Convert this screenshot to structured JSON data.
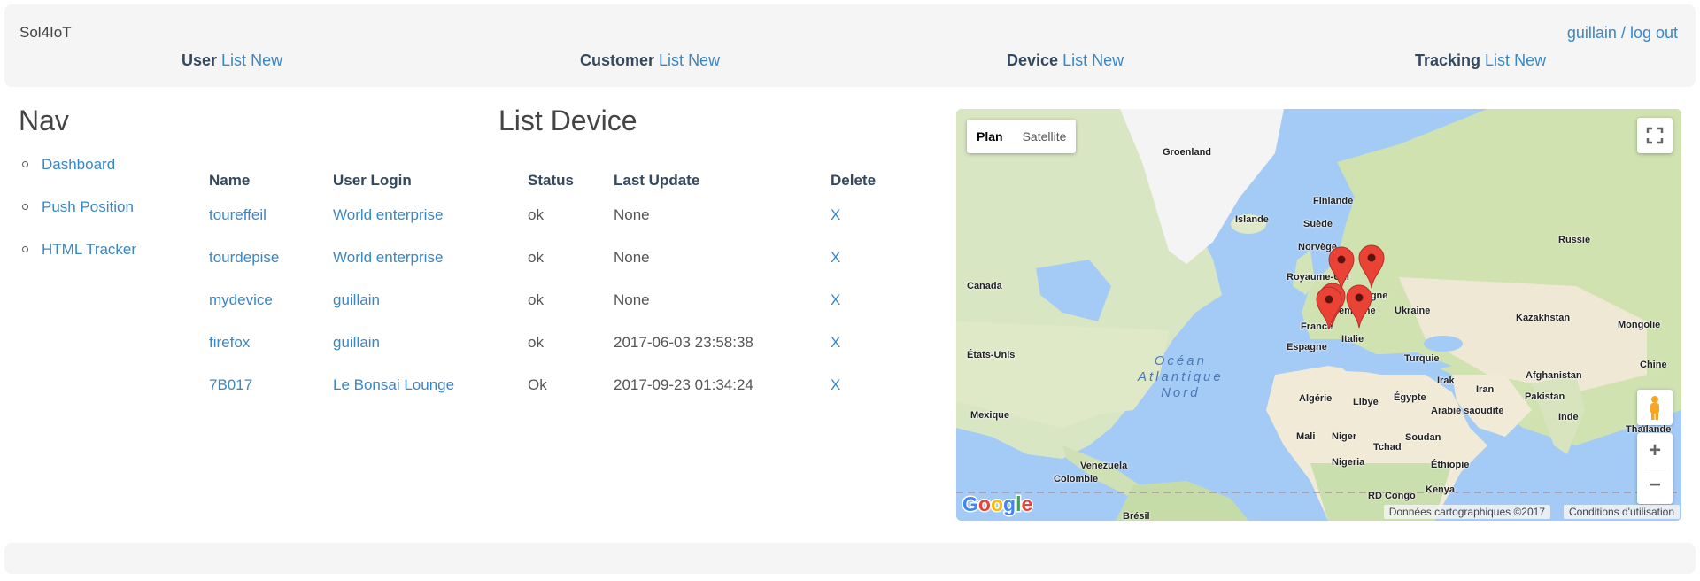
{
  "header": {
    "brand": "Sol4IoT",
    "user_name": "guillain",
    "separator": " / ",
    "logout_label": "log out",
    "menu": [
      {
        "section": "User",
        "list_label": "List",
        "new_label": "New"
      },
      {
        "section": "Customer",
        "list_label": "List",
        "new_label": "New"
      },
      {
        "section": "Device",
        "list_label": "List",
        "new_label": "New"
      },
      {
        "section": "Tracking",
        "list_label": "List",
        "new_label": "New"
      }
    ]
  },
  "nav": {
    "title": "Nav",
    "items": [
      {
        "label": "Dashboard"
      },
      {
        "label": "Push Position"
      },
      {
        "label": "HTML Tracker"
      }
    ]
  },
  "main": {
    "title": "List Device",
    "columns": [
      "Name",
      "User Login",
      "Status",
      "Last Update",
      "Delete"
    ],
    "rows": [
      {
        "name": "toureffeil",
        "user_login": "World enterprise",
        "status": "ok",
        "last_update": "None",
        "delete": "X"
      },
      {
        "name": "tourdepise",
        "user_login": "World enterprise",
        "status": "ok",
        "last_update": "None",
        "delete": "X"
      },
      {
        "name": "mydevice",
        "user_login": "guillain",
        "status": "ok",
        "last_update": "None",
        "delete": "X"
      },
      {
        "name": "firefox",
        "user_login": "guillain",
        "status": "ok",
        "last_update": "2017-06-03 23:58:38",
        "delete": "X"
      },
      {
        "name": "7B017",
        "user_login": "Le Bonsai Lounge",
        "status": "Ok",
        "last_update": "2017-09-23 01:34:24",
        "delete": "X"
      }
    ]
  },
  "map": {
    "type_controls": {
      "plan": "Plan",
      "satellite": "Satellite"
    },
    "zoom_in": "+",
    "zoom_out": "−",
    "attribution": "Données cartographiques ©2017",
    "terms": "Conditions d'utilisation",
    "logo": "Google",
    "ocean_label": [
      "Océan",
      "Atlantique",
      "Nord"
    ],
    "labels": [
      "Groenland",
      "Islande",
      "Finlande",
      "Suède",
      "Norvège",
      "Russie",
      "Canada",
      "Royaume-Uni",
      "Pologne",
      "France",
      "Allemagne",
      "Ukraine",
      "Kazakhstan",
      "Mongolie",
      "États-Unis",
      "Espagne",
      "Italie",
      "Turquie",
      "Chine",
      "Irak",
      "Afghanistan",
      "Iran",
      "Algérie",
      "Libye",
      "Égypte",
      "Pakistan",
      "Mexique",
      "Arabie saoudite",
      "Inde",
      "Thaïlande",
      "Mali",
      "Niger",
      "Soudan",
      "Tchad",
      "Nigeria",
      "Éthiopie",
      "Venezuela",
      "Colombie",
      "Kenya",
      "RD Congo",
      "Brésil"
    ],
    "marker_color": "#ea4335",
    "marker_count": 5
  },
  "colors": {
    "link": "#3a87c8",
    "header_bg": "#f5f5f5",
    "heading": "#34495e"
  }
}
